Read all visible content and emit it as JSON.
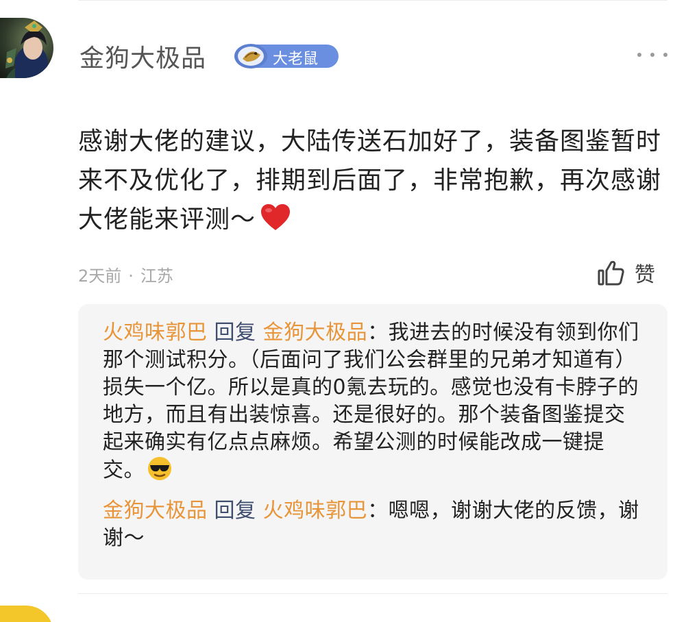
{
  "comment": {
    "username": "金狗大极品",
    "rank_label": "大老鼠",
    "body": "感谢大佬的建议，大陆传送石加好了，装备图鉴暂时来不及优化了，排期到后面了，非常抱歉，再次感谢大佬能来评测～",
    "time": "2天前",
    "separator": "·",
    "location": "江苏",
    "like_label": "赞"
  },
  "replies": [
    {
      "author": "火鸡味郭巴",
      "verb": "回复",
      "target": "金狗大极品",
      "colon": "：",
      "text": "我进去的时候没有领到你们那个测试积分。（后面问了我们公会群里的兄弟才知道有）损失一个亿。所以是真的0氪去玩的。感觉也没有卡脖子的地方，而且有出装惊喜。还是很好的。那个装备图鉴提交起来确实有亿点点麻烦。希望公测的时候能改成一键提交。"
    },
    {
      "author": "金狗大极品",
      "verb": "回复",
      "target": "火鸡味郭巴",
      "colon": "：",
      "text": "嗯嗯，谢谢大佬的反馈，谢谢～"
    }
  ],
  "colors": {
    "reply_name": "#e8953a",
    "reply_verb": "#3f4e6e",
    "rank_badge": "#6b8fe0",
    "meta_text": "#a8a8a8"
  },
  "icons": {
    "more": "more-dots-icon",
    "like": "thumbs-up-icon",
    "heart": "red-heart-emoji",
    "cool": "sunglasses-emoji"
  }
}
